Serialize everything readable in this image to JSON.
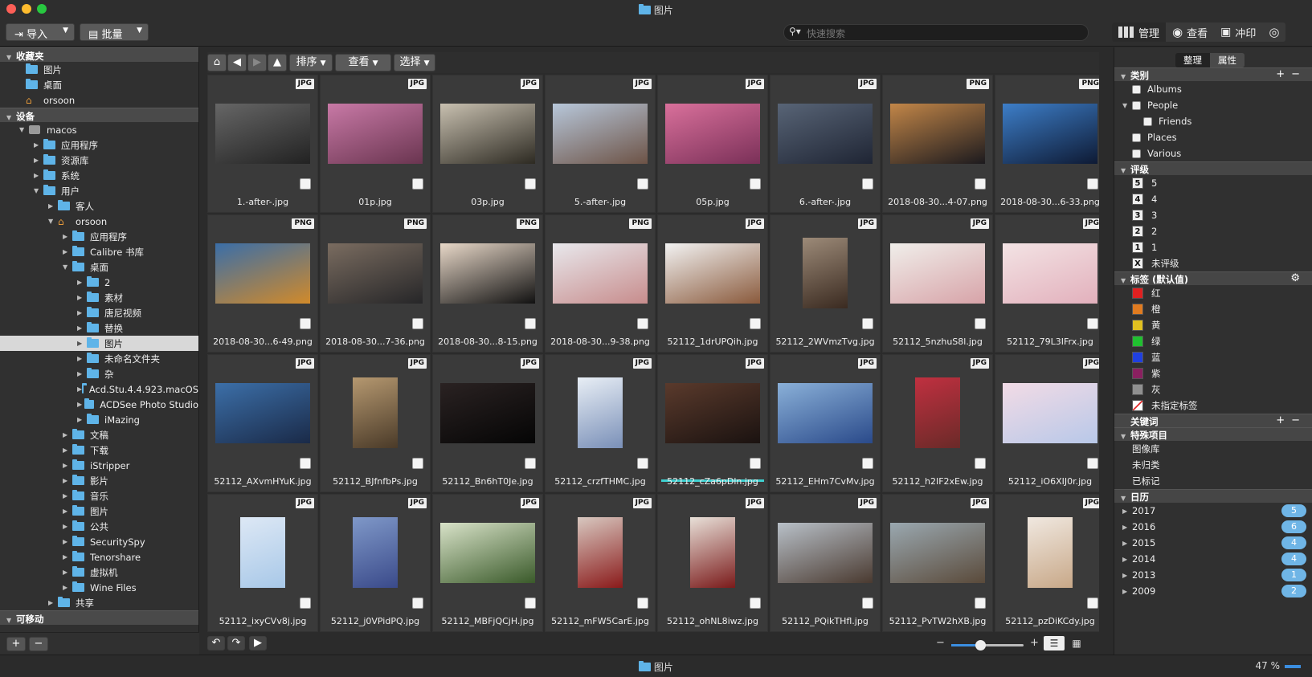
{
  "window": {
    "title": "图片"
  },
  "toolbar": {
    "import_label": "导入",
    "batch_label": "批量",
    "search_placeholder": "快速搜索",
    "modes": [
      "管理",
      "查看",
      "冲印"
    ]
  },
  "left": {
    "favorites_title": "收藏夹",
    "favorites": [
      "图片",
      "桌面",
      "orsoon"
    ],
    "devices_title": "设备",
    "tree": [
      {
        "label": "macos",
        "depth": 1,
        "open": true,
        "icon": "hdd-icon"
      },
      {
        "label": "应用程序",
        "depth": 2,
        "icon": "folder-icon"
      },
      {
        "label": "资源库",
        "depth": 2,
        "icon": "folder-icon"
      },
      {
        "label": "系统",
        "depth": 2,
        "icon": "folder-icon"
      },
      {
        "label": "用户",
        "depth": 2,
        "open": true,
        "icon": "folder-icon"
      },
      {
        "label": "客人",
        "depth": 3,
        "icon": "folder-icon"
      },
      {
        "label": "orsoon",
        "depth": 3,
        "open": true,
        "icon": "home-icon"
      },
      {
        "label": "应用程序",
        "depth": 4,
        "icon": "folder-icon"
      },
      {
        "label": "Calibre 书库",
        "depth": 4,
        "icon": "folder-icon"
      },
      {
        "label": "桌面",
        "depth": 4,
        "open": true,
        "icon": "folder-icon"
      },
      {
        "label": "2",
        "depth": 5,
        "icon": "folder-icon"
      },
      {
        "label": "素材",
        "depth": 5,
        "icon": "folder-icon"
      },
      {
        "label": "唐尼视频",
        "depth": 5,
        "icon": "folder-icon"
      },
      {
        "label": "替换",
        "depth": 5,
        "icon": "folder-icon"
      },
      {
        "label": "图片",
        "depth": 5,
        "icon": "folder-icon",
        "selected": true
      },
      {
        "label": "未命名文件夹",
        "depth": 5,
        "icon": "folder-icon"
      },
      {
        "label": "杂",
        "depth": 5,
        "icon": "folder-icon"
      },
      {
        "label": "Acd.Stu.4.4.923.macOS",
        "depth": 5,
        "icon": "folder-icon"
      },
      {
        "label": "ACDSee Photo Studio",
        "depth": 5,
        "icon": "folder-icon"
      },
      {
        "label": "iMazing",
        "depth": 5,
        "icon": "folder-icon"
      },
      {
        "label": "文稿",
        "depth": 4,
        "icon": "folder-icon"
      },
      {
        "label": "下载",
        "depth": 4,
        "icon": "folder-icon"
      },
      {
        "label": "iStripper",
        "depth": 4,
        "icon": "folder-icon"
      },
      {
        "label": "影片",
        "depth": 4,
        "icon": "folder-icon"
      },
      {
        "label": "音乐",
        "depth": 4,
        "icon": "folder-icon"
      },
      {
        "label": "图片",
        "depth": 4,
        "icon": "folder-icon"
      },
      {
        "label": "公共",
        "depth": 4,
        "icon": "folder-icon"
      },
      {
        "label": "SecuritySpy",
        "depth": 4,
        "icon": "folder-icon"
      },
      {
        "label": "Tenorshare",
        "depth": 4,
        "icon": "folder-icon"
      },
      {
        "label": "虚拟机",
        "depth": 4,
        "icon": "folder-icon"
      },
      {
        "label": "Wine Files",
        "depth": 4,
        "icon": "folder-icon"
      },
      {
        "label": "共享",
        "depth": 3,
        "icon": "folder-icon"
      }
    ],
    "removable_title": "可移动"
  },
  "nav": {
    "sort_label": "排序",
    "view_label": "查看",
    "select_label": "选择"
  },
  "files": [
    {
      "name": "1.-after-.jpg",
      "type": "JPG",
      "colors": [
        "#666",
        "#222"
      ]
    },
    {
      "name": "01p.jpg",
      "type": "JPG",
      "colors": [
        "#c879a6",
        "#6a3550"
      ]
    },
    {
      "name": "03p.jpg",
      "type": "JPG",
      "colors": [
        "#c8c0b0",
        "#2d2a22"
      ]
    },
    {
      "name": "5.-after-.jpg",
      "type": "JPG",
      "colors": [
        "#b7c7da",
        "#6d5346"
      ]
    },
    {
      "name": "05p.jpg",
      "type": "JPG",
      "colors": [
        "#d9709b",
        "#7a3058"
      ]
    },
    {
      "name": "6.-after-.jpg",
      "type": "JPG",
      "colors": [
        "#586476",
        "#1f2534"
      ]
    },
    {
      "name": "2018-08-30...4-07.png",
      "type": "PNG",
      "colors": [
        "#c28648",
        "#1c1a1e"
      ]
    },
    {
      "name": "2018-08-30...6-33.png",
      "type": "PNG",
      "colors": [
        "#3d7ec8",
        "#0e1a34"
      ]
    },
    {
      "name": "2018-08-30...6-49.png",
      "type": "PNG",
      "colors": [
        "#3a6ea8",
        "#d18a2a"
      ]
    },
    {
      "name": "2018-08-30...7-36.png",
      "type": "PNG",
      "colors": [
        "#7a6c60",
        "#262628"
      ]
    },
    {
      "name": "2018-08-30...8-15.png",
      "type": "PNG",
      "colors": [
        "#e8d8c8",
        "#111"
      ]
    },
    {
      "name": "2018-08-30...9-38.png",
      "type": "PNG",
      "colors": [
        "#e8e8ec",
        "#c78c8c"
      ]
    },
    {
      "name": "52112_1drUPQih.jpg",
      "type": "JPG",
      "colors": [
        "#f2f2f2",
        "#8a5a3c"
      ]
    },
    {
      "name": "52112_2WVmzTvg.jpg",
      "type": "JPG",
      "colors": [
        "#9c8a78",
        "#3a2a20"
      ],
      "portrait": true
    },
    {
      "name": "52112_5nzhuS8l.jpg",
      "type": "JPG",
      "colors": [
        "#f0eeea",
        "#d7a3a8"
      ]
    },
    {
      "name": "52112_79L3IFrx.jpg",
      "type": "JPG",
      "colors": [
        "#f3e3e4",
        "#e2b0bc"
      ]
    },
    {
      "name": "52112_AXvmHYuK.jpg",
      "type": "JPG",
      "colors": [
        "#3c6fa8",
        "#1a2a48"
      ]
    },
    {
      "name": "52112_BJfnfbPs.jpg",
      "type": "JPG",
      "colors": [
        "#b59870",
        "#4a3a28"
      ],
      "portrait": true
    },
    {
      "name": "52112_Bn6hT0Je.jpg",
      "type": "JPG",
      "colors": [
        "#2a2222",
        "#050505"
      ]
    },
    {
      "name": "52112_crzfTHMC.jpg",
      "type": "JPG",
      "colors": [
        "#e8eef5",
        "#7a90b8"
      ],
      "portrait": true
    },
    {
      "name": "52112_cZa6pDln.jpg",
      "type": "JPG",
      "colors": [
        "#5a3a2c",
        "#1a1210"
      ],
      "progress": 1.0
    },
    {
      "name": "52112_EHm7CvMv.jpg",
      "type": "JPG",
      "colors": [
        "#8ab0d8",
        "#2a4a8a"
      ]
    },
    {
      "name": "52112_h2IF2xEw.jpg",
      "type": "JPG",
      "colors": [
        "#c03040",
        "#6a2a28"
      ],
      "portrait": true
    },
    {
      "name": "52112_iO6XIJ0r.jpg",
      "type": "JPG",
      "colors": [
        "#f2dbe6",
        "#b8c8e8"
      ]
    },
    {
      "name": "52112_ixyCVv8j.jpg",
      "type": "JPG",
      "colors": [
        "#dde8f5",
        "#a8c8e8"
      ],
      "portrait": true
    },
    {
      "name": "52112_j0VPidPQ.jpg",
      "type": "JPG",
      "colors": [
        "#7f98c8",
        "#3a4a8a"
      ],
      "portrait": true
    },
    {
      "name": "52112_MBFjQCjH.jpg",
      "type": "JPG",
      "colors": [
        "#d8e2c8",
        "#3a5a2a"
      ]
    },
    {
      "name": "52112_mFW5CarE.jpg",
      "type": "JPG",
      "colors": [
        "#d8c8c0",
        "#8a1a1a"
      ],
      "portrait": true
    },
    {
      "name": "52112_ohNL8iwz.jpg",
      "type": "JPG",
      "colors": [
        "#e8e0d8",
        "#7a1a1a"
      ],
      "portrait": true
    },
    {
      "name": "52112_PQikTHfl.jpg",
      "type": "JPG",
      "colors": [
        "#b8c0c8",
        "#4a3a30"
      ]
    },
    {
      "name": "52112_PvTW2hXB.jpg",
      "type": "JPG",
      "colors": [
        "#9aa8b0",
        "#5a4a3a"
      ]
    },
    {
      "name": "52112_pzDiKCdy.jpg",
      "type": "JPG",
      "colors": [
        "#f0e8e0",
        "#c8a888"
      ],
      "portrait": true
    }
  ],
  "footer": {
    "zoom_minus": "−",
    "zoom_plus": "+",
    "zoom_level": 0.4
  },
  "right": {
    "tabs": [
      "整理",
      "属性"
    ],
    "categories_title": "类别",
    "categories": [
      {
        "label": "Albums",
        "indent": 0
      },
      {
        "label": "People",
        "indent": 0,
        "toggle": true
      },
      {
        "label": "Friends",
        "indent": 1
      },
      {
        "label": "Places",
        "indent": 0
      },
      {
        "label": "Various",
        "indent": 0
      }
    ],
    "rating_title": "评级",
    "ratings": [
      {
        "num": "5",
        "label": "5"
      },
      {
        "num": "4",
        "label": "4"
      },
      {
        "num": "3",
        "label": "3"
      },
      {
        "num": "2",
        "label": "2"
      },
      {
        "num": "1",
        "label": "1"
      },
      {
        "num": "X",
        "label": "未评级"
      }
    ],
    "labels_title": "标签 (默认值)",
    "labels": [
      {
        "label": "红",
        "color": "#e02020"
      },
      {
        "label": "橙",
        "color": "#e07b20"
      },
      {
        "label": "黄",
        "color": "#e0c020"
      },
      {
        "label": "绿",
        "color": "#20c030"
      },
      {
        "label": "蓝",
        "color": "#2040e0"
      },
      {
        "label": "紫",
        "color": "#8a2060"
      },
      {
        "label": "灰",
        "color": "#909090"
      },
      {
        "label": "未指定标签",
        "color": "#ffffff"
      }
    ],
    "keywords_title": "关键词",
    "special_title": "特殊项目",
    "special": [
      "图像库",
      "未归类",
      "已标记"
    ],
    "calendar_title": "日历",
    "years": [
      {
        "year": "2017",
        "count": "5"
      },
      {
        "year": "2016",
        "count": "6"
      },
      {
        "year": "2015",
        "count": "4"
      },
      {
        "year": "2014",
        "count": "4"
      },
      {
        "year": "2013",
        "count": "1"
      },
      {
        "year": "2009",
        "count": "2"
      }
    ]
  },
  "status": {
    "folder_label": "图片",
    "zoom": "47 %"
  }
}
